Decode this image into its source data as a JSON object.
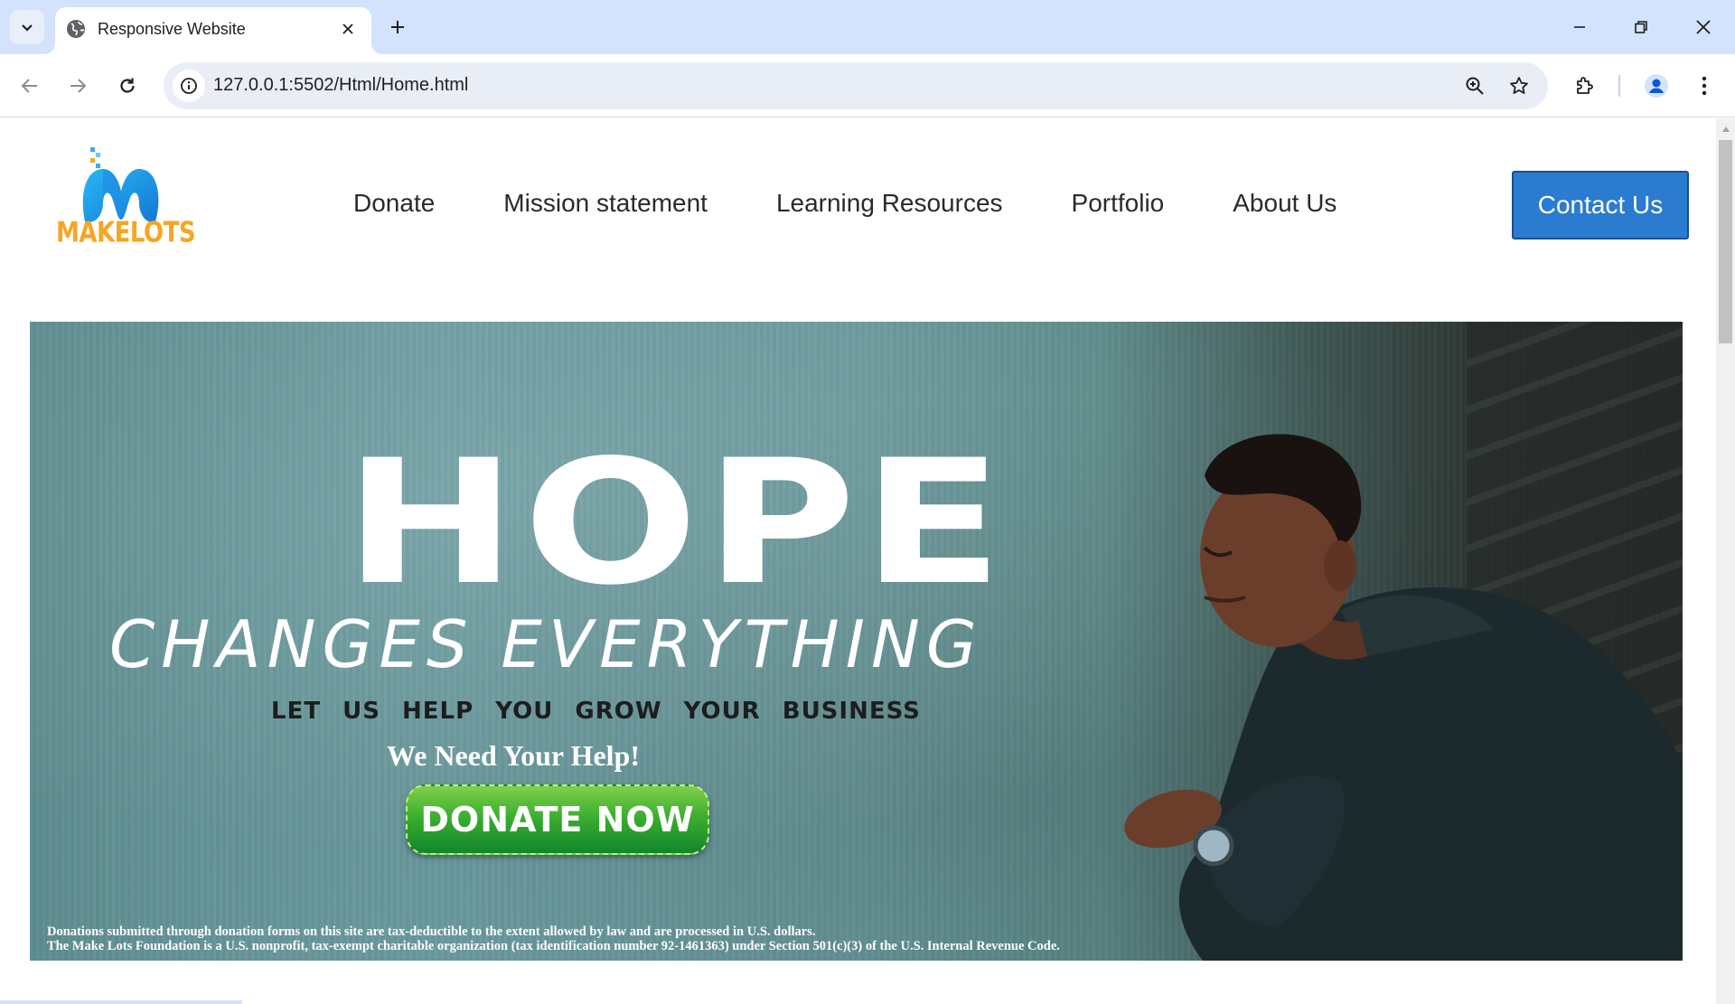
{
  "browser": {
    "tab_title": "Responsive Website",
    "url": "127.0.0.1:5502/Html/Home.html"
  },
  "site": {
    "logo_text": "MAKELOTS",
    "nav": [
      "Donate",
      "Mission statement",
      "Learning Resources",
      "Portfolio",
      "About Us"
    ],
    "contact_label": "Contact Us"
  },
  "hero": {
    "headline": "HOPE",
    "subheadline": "CHANGES EVERYTHING",
    "tagline": "LET US HELP YOU GROW YOUR BUSINESS",
    "plea": "We Need Your Help!",
    "cta": "DONATE NOW",
    "disclaimer_line1": "Donations submitted through donation forms on this site are tax-deductible to the extent allowed by law and are processed in U.S. dollars.",
    "disclaimer_line2": "The Make Lots Foundation is a U.S. nonprofit, tax-exempt charitable organization (tax identification number 92-1461363) under Section 501(c)(3) of the U.S. Internal Revenue Code."
  },
  "colors": {
    "accent": "#2b7bd1",
    "logo_orange": "#f6a623",
    "cta_green": "#3cae30",
    "chrome_tabstrip": "#d3e3fd"
  }
}
